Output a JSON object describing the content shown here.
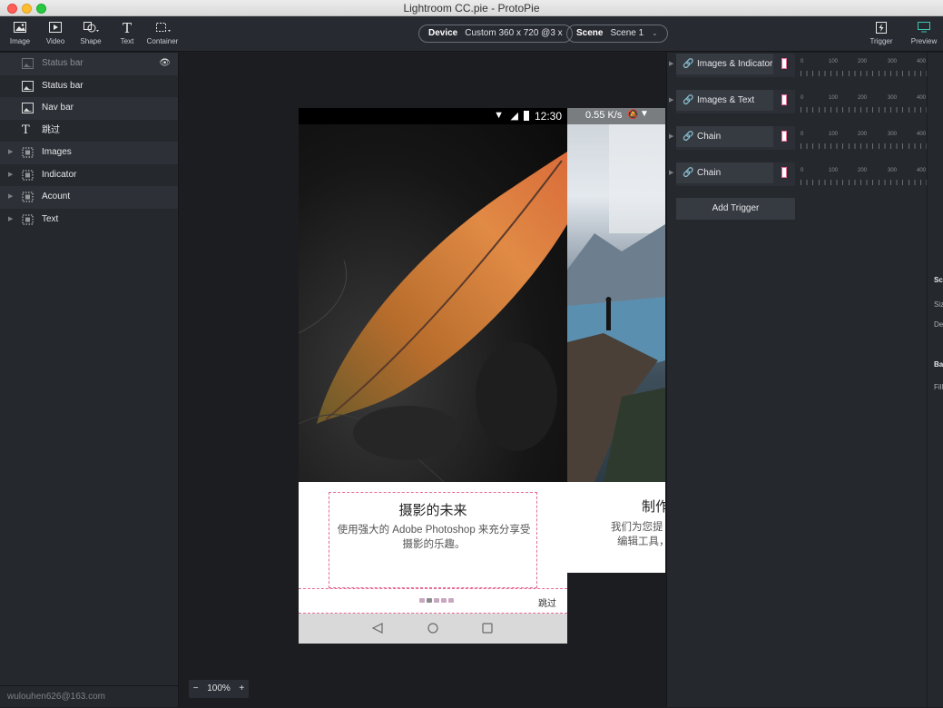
{
  "window": {
    "title": "Lightroom CC.pie - ProtoPie"
  },
  "toolbar": {
    "tools": [
      {
        "label": "Image",
        "icon": "image-icon"
      },
      {
        "label": "Video",
        "icon": "video-icon"
      },
      {
        "label": "Shape",
        "icon": "shape-icon"
      },
      {
        "label": "Text",
        "icon": "text-icon"
      },
      {
        "label": "Container",
        "icon": "container-icon"
      }
    ],
    "device": {
      "label": "Device",
      "value": "Custom  360 x 720  @3 x"
    },
    "scene": {
      "label": "Scene",
      "value": "Scene 1"
    },
    "trigger_label": "Trigger",
    "preview_label": "Preview"
  },
  "layers": [
    {
      "label": "Status bar",
      "icon": "image-icon",
      "hidden": true
    },
    {
      "label": "Status bar",
      "icon": "image-icon"
    },
    {
      "label": "Nav bar",
      "icon": "image-icon"
    },
    {
      "label": "跳过",
      "icon": "text-icon"
    },
    {
      "label": "Images",
      "icon": "container-icon",
      "expandable": true
    },
    {
      "label": "Indicator",
      "icon": "container-icon",
      "expandable": true
    },
    {
      "label": "Acount",
      "icon": "container-icon",
      "expandable": true
    },
    {
      "label": "Text",
      "icon": "container-icon",
      "expandable": true
    }
  ],
  "account": "wulouhen626@163.com",
  "canvas": {
    "zoom": "100%",
    "zoom_out": "−",
    "zoom_in": "+",
    "phone": {
      "time": "12:30",
      "title": "摄影的未来",
      "body": "使用强大的 Adobe Photoshop 来充分享受摄影的乐趣。",
      "skip": "跳过"
    },
    "phone2": {
      "speed": "0.55 K/s",
      "title": "制作",
      "body_1": "我们为您提",
      "body_2": "编辑工具，"
    }
  },
  "triggers": [
    {
      "name": "Images & Indicator"
    },
    {
      "name": "Images & Text"
    },
    {
      "name": "Chain"
    },
    {
      "name": "Chain"
    }
  ],
  "add_trigger": "Add Trigger",
  "ruler_labels": [
    "0",
    "100",
    "200",
    "300",
    "400"
  ],
  "props_cutoff": {
    "scene": "Sce",
    "size": "Siz",
    "device": "Dev",
    "background": "Bac",
    "fill": "Fill"
  },
  "colors": {
    "accent_pink": "#e56b94",
    "panel": "#25282d",
    "canvas": "#1b1d21"
  }
}
